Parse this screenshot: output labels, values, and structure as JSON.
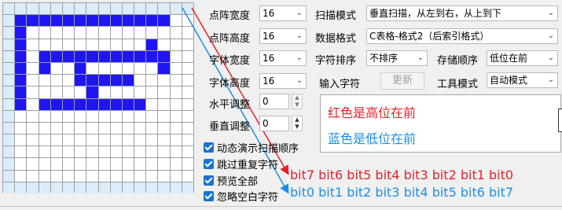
{
  "grid": {
    "cols": 16,
    "rows": 16,
    "on": [
      [
        1,
        1
      ],
      [
        2,
        1
      ],
      [
        3,
        1
      ],
      [
        4,
        1
      ],
      [
        5,
        1
      ],
      [
        6,
        1
      ],
      [
        7,
        1
      ],
      [
        8,
        1
      ],
      [
        9,
        1
      ],
      [
        10,
        1
      ],
      [
        11,
        1
      ],
      [
        12,
        1
      ],
      [
        13,
        1
      ],
      [
        1,
        2
      ],
      [
        1,
        3
      ],
      [
        1,
        4
      ],
      [
        1,
        5
      ],
      [
        1,
        6
      ],
      [
        1,
        7
      ],
      [
        1,
        8
      ],
      [
        3,
        4
      ],
      [
        4,
        4
      ],
      [
        5,
        4
      ],
      [
        6,
        4
      ],
      [
        7,
        4
      ],
      [
        8,
        4
      ],
      [
        9,
        4
      ],
      [
        10,
        4
      ],
      [
        11,
        4
      ],
      [
        12,
        4
      ],
      [
        13,
        4
      ],
      [
        3,
        5
      ],
      [
        13,
        5
      ],
      [
        6,
        5
      ],
      [
        6,
        6
      ],
      [
        7,
        6
      ],
      [
        8,
        6
      ],
      [
        9,
        6
      ],
      [
        10,
        6
      ],
      [
        7,
        7
      ],
      [
        3,
        8
      ],
      [
        4,
        8
      ],
      [
        5,
        8
      ],
      [
        6,
        8
      ],
      [
        7,
        8
      ],
      [
        8,
        8
      ],
      [
        9,
        8
      ],
      [
        10,
        8
      ],
      [
        11,
        8
      ],
      [
        12,
        3
      ]
    ],
    "shade_col": [
      0
    ],
    "shade_row": [
      0,
      15
    ]
  },
  "settings": {
    "dot_width_label": "点阵宽度",
    "dot_width_value": "16",
    "dot_height_label": "点阵高度",
    "dot_height_value": "16",
    "font_width_label": "字体宽度",
    "font_width_value": "16",
    "font_height_label": "字体高度",
    "font_height_value": "16",
    "h_adjust_label": "水平调整",
    "h_adjust_value": "0",
    "v_adjust_label": "垂直调整",
    "v_adjust_value": "0"
  },
  "scan": {
    "scan_mode_label": "扫描模式",
    "scan_mode_value": "垂直扫描，从左到右，从上到下",
    "data_format_label": "数据格式",
    "data_format_value": "C表格-格式2（后索引格式）",
    "char_sort_label": "字符排序",
    "char_sort_value": "不排序",
    "store_order_label": "存储顺序",
    "store_order_value": "低位在前",
    "input_char_label": "输入字符",
    "update_button": "更新",
    "tool_mode_label": "工具模式",
    "tool_mode_value": "自动模式"
  },
  "checkboxes": {
    "animate_label": "动态演示扫描顺序",
    "skip_dup_label": "跳过重复字符",
    "preview_all_label": "预览全部",
    "ignore_blank_label": "忽略空白字符"
  },
  "notes": {
    "red_note": "红色是高位在前",
    "blue_note": "蓝色是低位在前",
    "red_bits": "bit7 bit6 bit5 bit4 bit3 bit2 bit1 bit0",
    "blue_bits": "bit0 bit1 bit2 bit3 bit4 bit5 bit6 bit7"
  },
  "colors": {
    "pixel_on": "#1f16f2",
    "red_arrow": "#e4222b",
    "blue_arrow": "#1e8fe6"
  },
  "icons": {
    "dropdown": "chevron-down-icon",
    "spin": "spin-arrows-icon",
    "check": "checkmark-icon"
  }
}
